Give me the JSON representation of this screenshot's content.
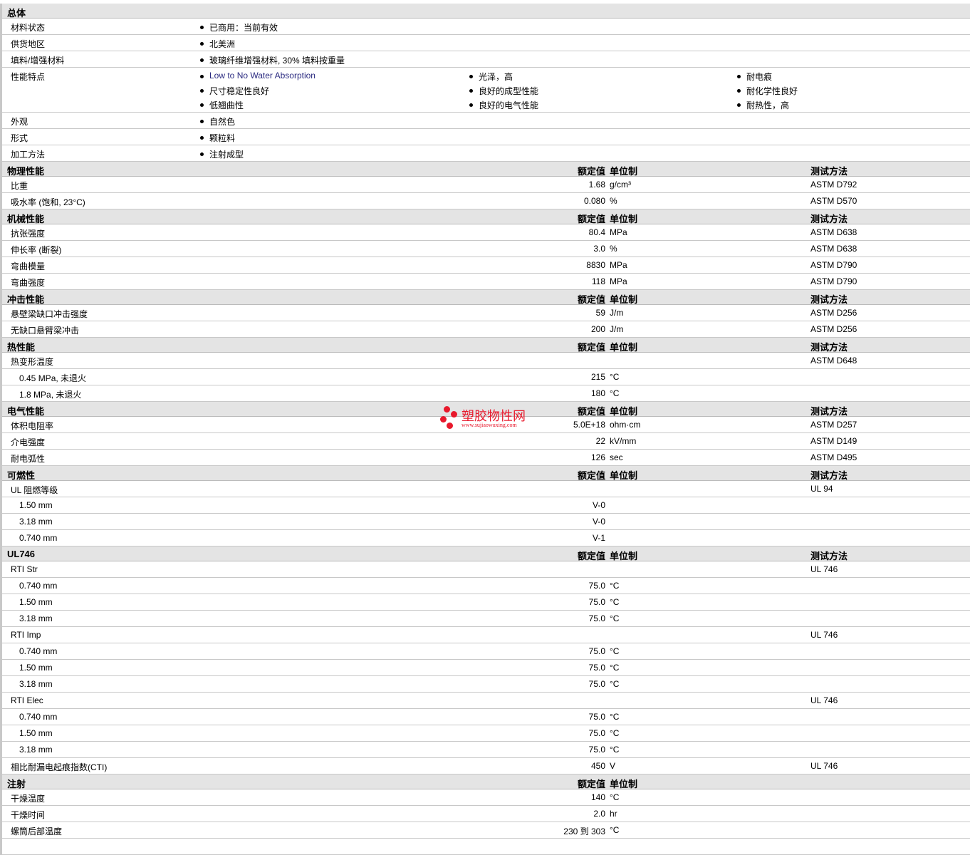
{
  "general": {
    "title": "总体",
    "rows": [
      {
        "label": "材料状态",
        "items": [
          "已商用：当前有效"
        ]
      },
      {
        "label": "供货地区",
        "items": [
          "北美洲"
        ]
      },
      {
        "label": "填料/增强材料",
        "items": [
          "玻璃纤维增强材料, 30% 填料按重量"
        ]
      },
      {
        "label": "性能特点",
        "items": [
          "Low to No Water Absorption",
          "尺寸稳定性良好",
          "低翘曲性",
          "光泽，高",
          "良好的成型性能",
          "良好的电气性能",
          "耐电痕",
          "耐化学性良好",
          "耐热性，高"
        ]
      },
      {
        "label": "外观",
        "items": [
          "自然色"
        ]
      },
      {
        "label": "形式",
        "items": [
          "颗粒料"
        ]
      },
      {
        "label": "加工方法",
        "items": [
          "注射成型"
        ]
      }
    ]
  },
  "column_headers": {
    "value": "额定值",
    "unit": "单位制",
    "method": "测试方法"
  },
  "sections": [
    {
      "title": "物理性能",
      "method_header": true,
      "rows": [
        {
          "label": "比重",
          "value": "1.68",
          "unit": "g/cm³",
          "method": "ASTM D792"
        },
        {
          "label": "吸水率 (饱和, 23°C)",
          "value": "0.080",
          "unit": "%",
          "method": "ASTM D570"
        }
      ]
    },
    {
      "title": "机械性能",
      "method_header": true,
      "rows": [
        {
          "label": "抗张强度",
          "value": "80.4",
          "unit": "MPa",
          "method": "ASTM D638"
        },
        {
          "label": "伸长率 (断裂)",
          "value": "3.0",
          "unit": "%",
          "method": "ASTM D638"
        },
        {
          "label": "弯曲模量",
          "value": "8830",
          "unit": "MPa",
          "method": "ASTM D790"
        },
        {
          "label": "弯曲强度",
          "value": "118",
          "unit": "MPa",
          "method": "ASTM D790"
        }
      ]
    },
    {
      "title": "冲击性能",
      "method_header": true,
      "rows": [
        {
          "label": "悬壁梁缺口冲击强度",
          "value": "59",
          "unit": "J/m",
          "method": "ASTM D256"
        },
        {
          "label": "无缺口悬臂梁冲击",
          "value": "200",
          "unit": "J/m",
          "method": "ASTM D256"
        }
      ]
    },
    {
      "title": "热性能",
      "method_header": true,
      "rows": [
        {
          "label": "热变形温度",
          "value": "",
          "unit": "",
          "method": "ASTM D648"
        },
        {
          "label": "0.45 MPa, 未退火",
          "sub": true,
          "value": "215",
          "unit": "°C",
          "method": ""
        },
        {
          "label": "1.8 MPa, 未退火",
          "sub": true,
          "value": "180",
          "unit": "°C",
          "method": ""
        }
      ]
    },
    {
      "title": "电气性能",
      "method_header": true,
      "rows": [
        {
          "label": "体积电阻率",
          "value": "5.0E+18",
          "unit": "ohm·cm",
          "method": "ASTM D257"
        },
        {
          "label": "介电强度",
          "value": "22",
          "unit": "kV/mm",
          "method": "ASTM D149"
        },
        {
          "label": "耐电弧性",
          "value": "126",
          "unit": "sec",
          "method": "ASTM D495"
        }
      ]
    },
    {
      "title": "可燃性",
      "method_header": true,
      "rows": [
        {
          "label": "UL 阻燃等级",
          "value": "",
          "unit": "",
          "method": "UL 94"
        },
        {
          "label": "1.50 mm",
          "sub": true,
          "value": "V-0",
          "unit": "",
          "method": ""
        },
        {
          "label": "3.18 mm",
          "sub": true,
          "value": "V-0",
          "unit": "",
          "method": ""
        },
        {
          "label": "0.740 mm",
          "sub": true,
          "value": "V-1",
          "unit": "",
          "method": ""
        }
      ]
    },
    {
      "title": "UL746",
      "method_header": true,
      "rows": [
        {
          "label": "RTI Str",
          "value": "",
          "unit": "",
          "method": "UL 746"
        },
        {
          "label": "0.740 mm",
          "sub": true,
          "value": "75.0",
          "unit": "°C",
          "method": ""
        },
        {
          "label": "1.50 mm",
          "sub": true,
          "value": "75.0",
          "unit": "°C",
          "method": ""
        },
        {
          "label": "3.18 mm",
          "sub": true,
          "value": "75.0",
          "unit": "°C",
          "method": ""
        },
        {
          "label": "RTI Imp",
          "value": "",
          "unit": "",
          "method": "UL 746"
        },
        {
          "label": "0.740 mm",
          "sub": true,
          "value": "75.0",
          "unit": "°C",
          "method": ""
        },
        {
          "label": "1.50 mm",
          "sub": true,
          "value": "75.0",
          "unit": "°C",
          "method": ""
        },
        {
          "label": "3.18 mm",
          "sub": true,
          "value": "75.0",
          "unit": "°C",
          "method": ""
        },
        {
          "label": "RTI Elec",
          "value": "",
          "unit": "",
          "method": "UL 746"
        },
        {
          "label": "0.740 mm",
          "sub": true,
          "value": "75.0",
          "unit": "°C",
          "method": ""
        },
        {
          "label": "1.50 mm",
          "sub": true,
          "value": "75.0",
          "unit": "°C",
          "method": ""
        },
        {
          "label": "3.18 mm",
          "sub": true,
          "value": "75.0",
          "unit": "°C",
          "method": ""
        },
        {
          "label": "相比耐漏电起痕指数(CTI)",
          "value": "450",
          "unit": "V",
          "method": "UL 746"
        }
      ]
    },
    {
      "title": "注射",
      "method_header": false,
      "rows": [
        {
          "label": "干燥温度",
          "value": "140",
          "unit": "°C",
          "method": ""
        },
        {
          "label": "干燥时间",
          "value": "2.0",
          "unit": "hr",
          "method": ""
        },
        {
          "label": "螺筒后部温度",
          "value": "230 到 303",
          "unit": "°C",
          "method": ""
        }
      ]
    }
  ],
  "watermark": {
    "name": "塑胶物性网",
    "url": "www.sujiaowuxing.com",
    "color": "#e8192c"
  }
}
